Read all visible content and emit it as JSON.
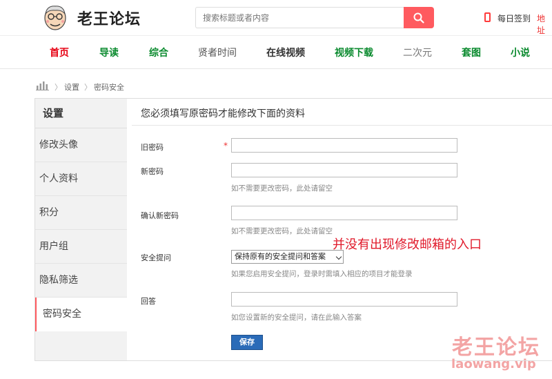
{
  "header": {
    "site_name": "老王论坛",
    "search_placeholder": "搜索标题或者内容",
    "checkin_label": "每日签到",
    "address_label": "地址"
  },
  "nav": {
    "items": [
      {
        "label": "首页",
        "color": "#e60012"
      },
      {
        "label": "导读",
        "color": "#0a8a2e"
      },
      {
        "label": "综合",
        "color": "#0a8a2e"
      },
      {
        "label": "贤者时间",
        "color": "#555555"
      },
      {
        "label": "在线视频",
        "color": "#333333"
      },
      {
        "label": "视频下载",
        "color": "#0a8a2e"
      },
      {
        "label": "二次元",
        "color": "#777777"
      },
      {
        "label": "套图",
        "color": "#0a8a2e"
      },
      {
        "label": "小说",
        "color": "#0a8a2e"
      }
    ]
  },
  "breadcrumb": {
    "items": [
      "设置",
      "密码安全"
    ],
    "separator": "〉"
  },
  "sidebar": {
    "title": "设置",
    "items": [
      {
        "label": "修改头像"
      },
      {
        "label": "个人资料"
      },
      {
        "label": "积分"
      },
      {
        "label": "用户组"
      },
      {
        "label": "隐私筛选"
      },
      {
        "label": "密码安全",
        "active": true
      }
    ]
  },
  "form": {
    "title": "您必须填写原密码才能修改下面的资料",
    "old_password_label": "旧密码",
    "required_mark": "*",
    "new_password_label": "新密码",
    "new_password_hint": "如不需要更改密码，此处请留空",
    "confirm_password_label": "确认新密码",
    "confirm_password_hint": "如不需要更改密码，此处请留空",
    "security_question_label": "安全提问",
    "security_question_value": "保持原有的安全提问和答案",
    "security_question_hint": "如果您启用安全提问，登录时需填入相应的项目才能登录",
    "answer_label": "回答",
    "answer_hint": "如您设置新的安全提问，请在此输入答案",
    "save_label": "保存"
  },
  "annotation": "并没有出现修改邮箱的入口",
  "watermark": {
    "cn": "老王论坛",
    "en": "laowang.vip"
  },
  "colors": {
    "accent": "#ff5a5f",
    "save_button": "#2a6bb8",
    "annotation": "#e0192a",
    "watermark": "#f3a4a4"
  }
}
